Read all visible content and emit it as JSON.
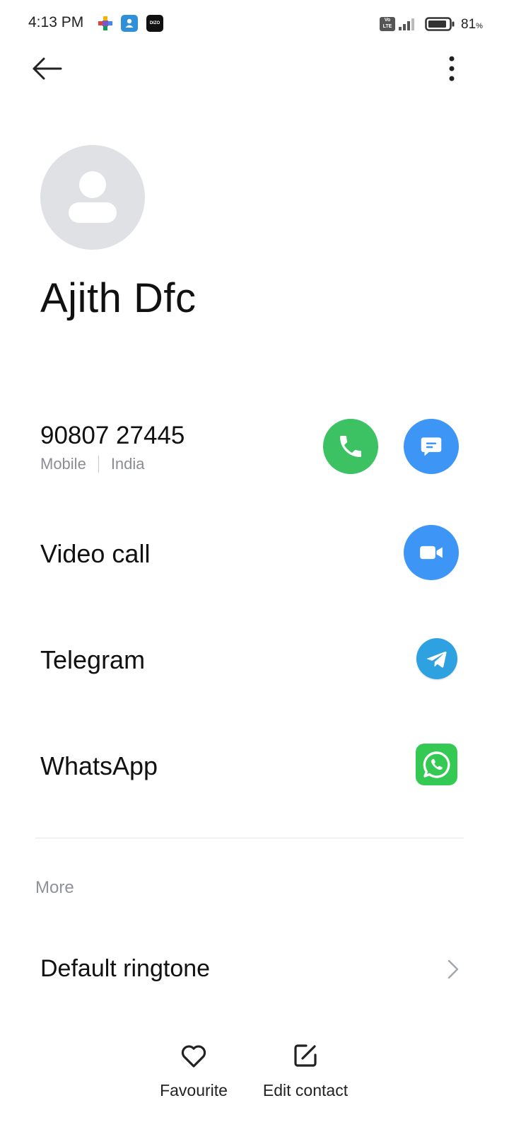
{
  "status_bar": {
    "time": "4:13 PM",
    "notification_icons": [
      "puzzle-app-icon",
      "contacts-app-icon",
      "dizo-app-icon"
    ],
    "dizo_label": "DIZO",
    "volte": "Vo LTE",
    "battery_percent": "81",
    "battery_unit": "%"
  },
  "contact": {
    "name": "Ajith Dfc",
    "phone": "90807 27445",
    "phone_type": "Mobile",
    "phone_region": "India"
  },
  "actions": {
    "video_call": "Video call",
    "telegram": "Telegram",
    "whatsapp": "WhatsApp"
  },
  "more": {
    "section_title": "More",
    "default_ringtone": "Default ringtone"
  },
  "bottom_bar": {
    "favourite": "Favourite",
    "edit_contact": "Edit contact"
  },
  "colors": {
    "call_green": "#3cc262",
    "message_blue": "#3d95f5",
    "telegram_blue": "#2ea2e0",
    "whatsapp_green": "#33c953",
    "avatar_gray": "#dfe1e5"
  }
}
